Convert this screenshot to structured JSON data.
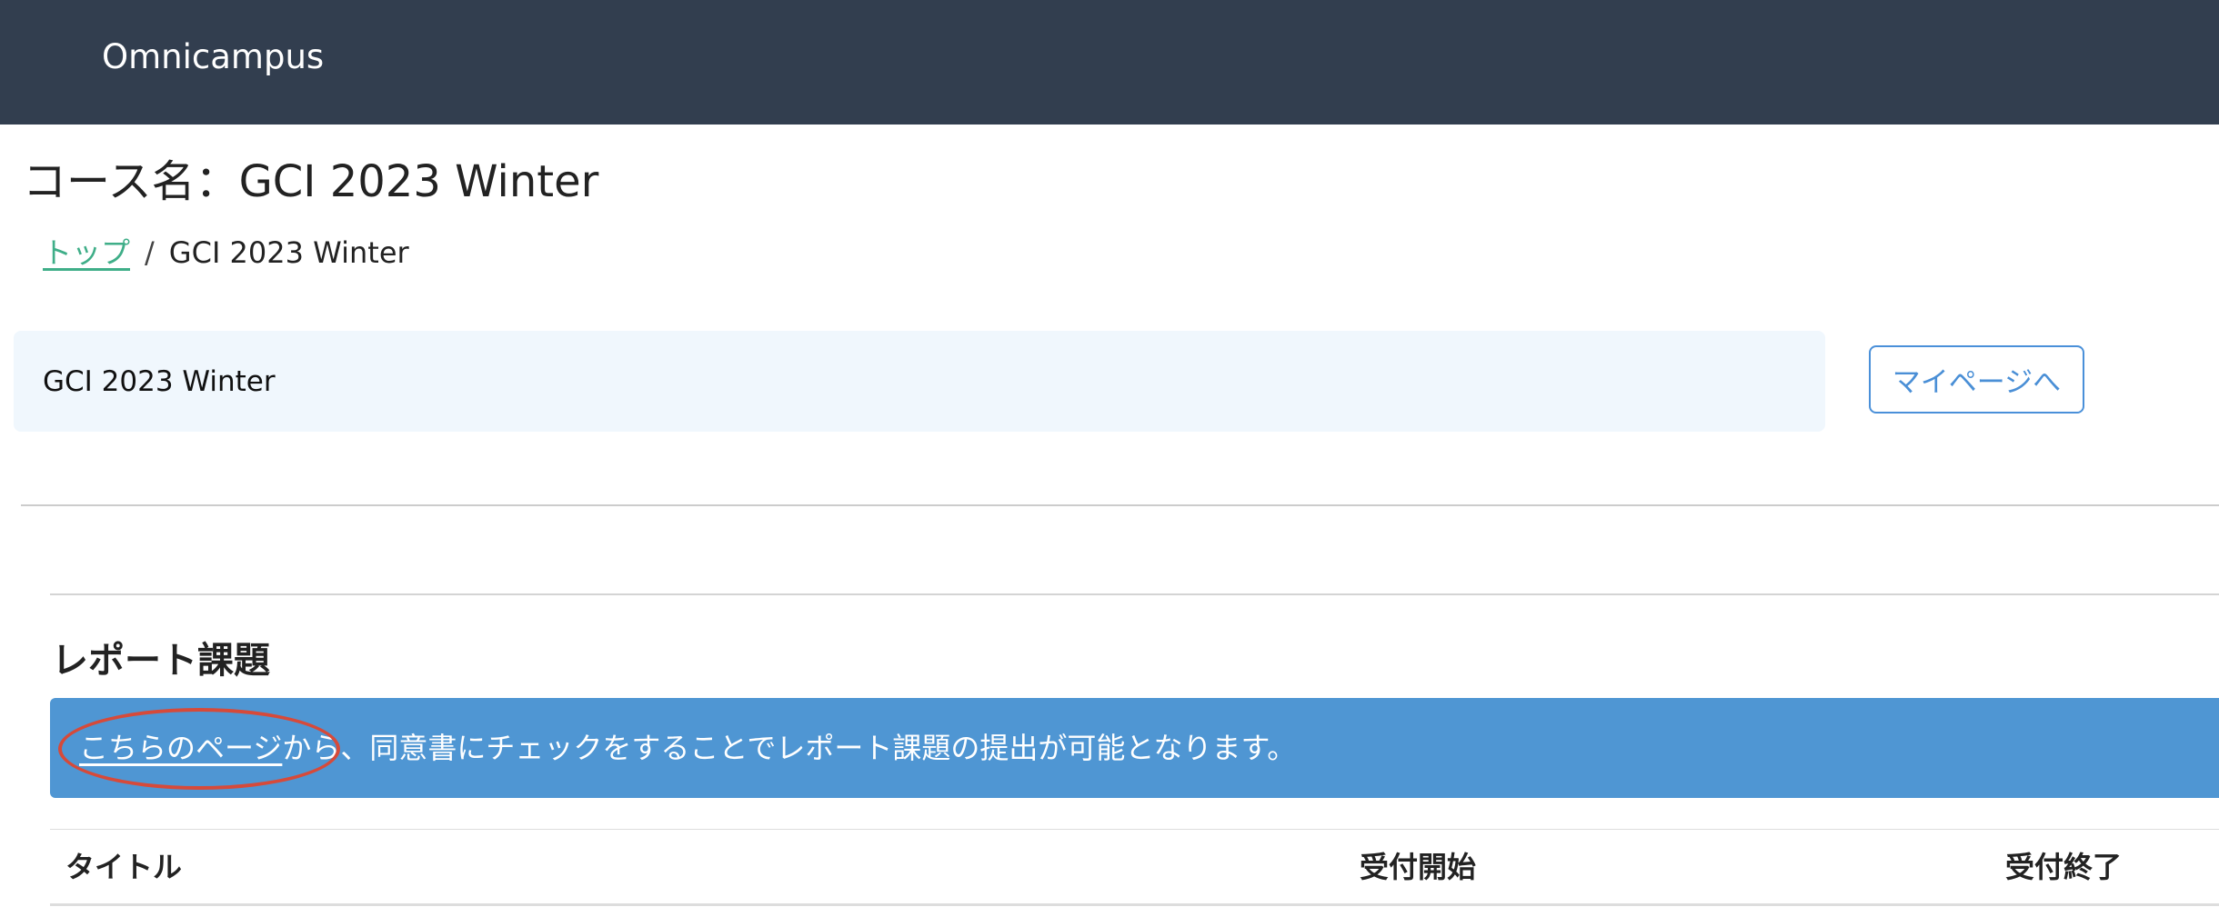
{
  "navbar": {
    "brand": "Omnicampus"
  },
  "page": {
    "title": "コース名：GCI 2023 Winter"
  },
  "breadcrumb": {
    "home_label": "トップ",
    "separator": "/",
    "current_label": "GCI 2023 Winter"
  },
  "course_box": {
    "label": "GCI 2023 Winter",
    "mypage_button_label": "マイページへ"
  },
  "report_section": {
    "heading": "レポート課題",
    "notice": {
      "link_text": "こちらのページ",
      "rest_text": "から、同意書にチェックをすることでレポート課題の提出が可能となります。"
    },
    "table": {
      "columns": [
        "タイトル",
        "受付開始",
        "受付終了"
      ]
    }
  },
  "colors": {
    "navbar_bg": "#323e4f",
    "link_green": "#3fae88",
    "accent_blue": "#4f96d3",
    "button_border": "#4a90d9",
    "annotation_red": "#d64a3a"
  }
}
